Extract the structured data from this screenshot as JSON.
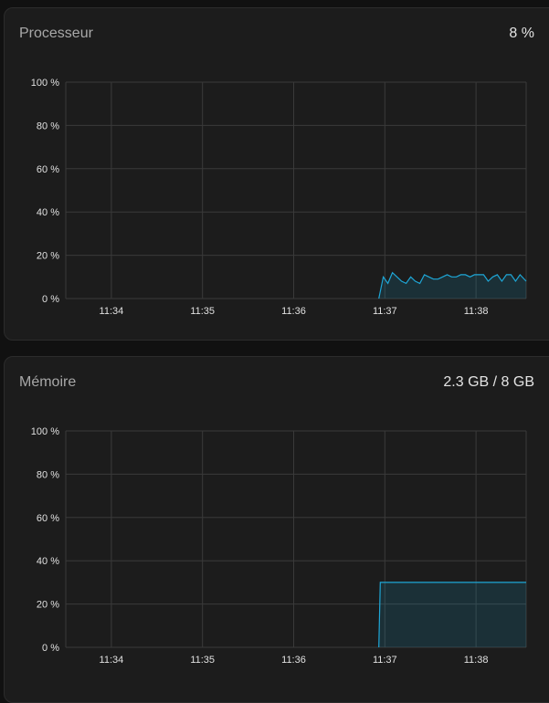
{
  "panels": [
    {
      "title": "Processeur",
      "value": "8 %",
      "chart_data": {
        "type": "area",
        "x_ticks": [
          "11:34",
          "11:35",
          "11:36",
          "11:37",
          "11:38"
        ],
        "y_ticks": [
          "0 %",
          "20 %",
          "40 %",
          "60 %",
          "80 %",
          "100 %"
        ],
        "ylim": [
          0,
          100
        ],
        "xlim": [
          "11:33:30",
          "11:38:33"
        ],
        "grid": true,
        "color": "#1ea6d6",
        "series": [
          {
            "x": [
              "11:36:56",
              "11:36:59",
              "11:37:02",
              "11:37:05",
              "11:37:08",
              "11:37:11",
              "11:37:14",
              "11:37:17",
              "11:37:20",
              "11:37:23",
              "11:37:26",
              "11:37:29",
              "11:37:32",
              "11:37:35",
              "11:37:38",
              "11:37:41",
              "11:37:44",
              "11:37:47",
              "11:37:50",
              "11:37:53",
              "11:37:56",
              "11:37:59",
              "11:38:02",
              "11:38:05",
              "11:38:08",
              "11:38:11",
              "11:38:14",
              "11:38:17",
              "11:38:20",
              "11:38:23",
              "11:38:26",
              "11:38:29",
              "11:38:33"
            ],
            "values": [
              0,
              10,
              7,
              12,
              10,
              8,
              7,
              10,
              8,
              7,
              11,
              10,
              9,
              9,
              10,
              11,
              10,
              10,
              11,
              11,
              10,
              11,
              11,
              11,
              8,
              10,
              11,
              8,
              11,
              11,
              8,
              11,
              8
            ]
          }
        ]
      }
    },
    {
      "title": "Mémoire",
      "value": "2.3 GB / 8 GB",
      "chart_data": {
        "type": "area",
        "x_ticks": [
          "11:34",
          "11:35",
          "11:36",
          "11:37",
          "11:38"
        ],
        "y_ticks": [
          "0 %",
          "20 %",
          "40 %",
          "60 %",
          "80 %",
          "100 %"
        ],
        "ylim": [
          0,
          100
        ],
        "xlim": [
          "11:33:30",
          "11:38:33"
        ],
        "grid": true,
        "color": "#1ea6d6",
        "series": [
          {
            "x": [
              "11:36:56",
              "11:36:57",
              "11:37:20",
              "11:37:40",
              "11:38:00",
              "11:38:20",
              "11:38:33"
            ],
            "values": [
              0,
              30,
              30,
              30,
              30,
              30,
              30
            ]
          }
        ]
      }
    }
  ]
}
